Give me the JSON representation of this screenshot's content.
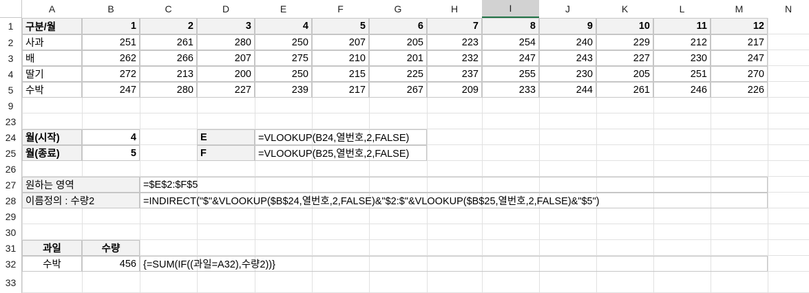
{
  "columns": [
    "A",
    "B",
    "C",
    "D",
    "E",
    "F",
    "G",
    "H",
    "I",
    "J",
    "K",
    "L",
    "M",
    "N"
  ],
  "selected_column": "I",
  "rows": [
    "1",
    "2",
    "3",
    "4",
    "5",
    "9",
    "23",
    "24",
    "25",
    "26",
    "27",
    "28",
    "29",
    "30",
    "31",
    "32",
    "33"
  ],
  "table": {
    "header_label": "구분/월",
    "months": [
      "1",
      "2",
      "3",
      "4",
      "5",
      "6",
      "7",
      "8",
      "9",
      "10",
      "11",
      "12"
    ],
    "fruits": [
      {
        "name": "사과",
        "values": [
          "251",
          "261",
          "280",
          "250",
          "207",
          "205",
          "223",
          "254",
          "240",
          "229",
          "212",
          "217"
        ]
      },
      {
        "name": "배",
        "values": [
          "262",
          "266",
          "207",
          "275",
          "210",
          "201",
          "232",
          "247",
          "243",
          "227",
          "230",
          "247"
        ]
      },
      {
        "name": "딸기",
        "values": [
          "272",
          "213",
          "200",
          "250",
          "215",
          "225",
          "237",
          "255",
          "230",
          "205",
          "251",
          "270"
        ]
      },
      {
        "name": "수박",
        "values": [
          "247",
          "280",
          "227",
          "239",
          "217",
          "267",
          "209",
          "233",
          "244",
          "261",
          "246",
          "226"
        ]
      }
    ]
  },
  "inputs": {
    "start_label": "월(시작)",
    "start_value": "4",
    "end_label": "월(종료)",
    "end_value": "5"
  },
  "formulas": {
    "e_label": "E",
    "e_formula": "=VLOOKUP(B24,열번호,2,FALSE)",
    "f_label": "F",
    "f_formula": "=VLOOKUP(B25,열번호,2,FALSE)"
  },
  "range": {
    "desired_label": "원하는 영역",
    "desired_value": "=$E$2:$F$5",
    "name_label": "이름정의 : 수량2",
    "name_value": "=INDIRECT(\"$\"&VLOOKUP($B$24,열번호,2,FALSE)&\"$2:$\"&VLOOKUP($B$25,열번호,2,FALSE)&\"$5\")"
  },
  "result": {
    "fruit_header": "과일",
    "qty_header": "수량",
    "fruit": "수박",
    "qty": "456",
    "formula": "{=SUM(IF((과일=A32),수량2))}"
  },
  "colors": {
    "gridline": "#e1e1e1",
    "header_fill": "#f2f2f2",
    "border": "#c6c6c6",
    "selected_header": "#d2d2d2"
  }
}
